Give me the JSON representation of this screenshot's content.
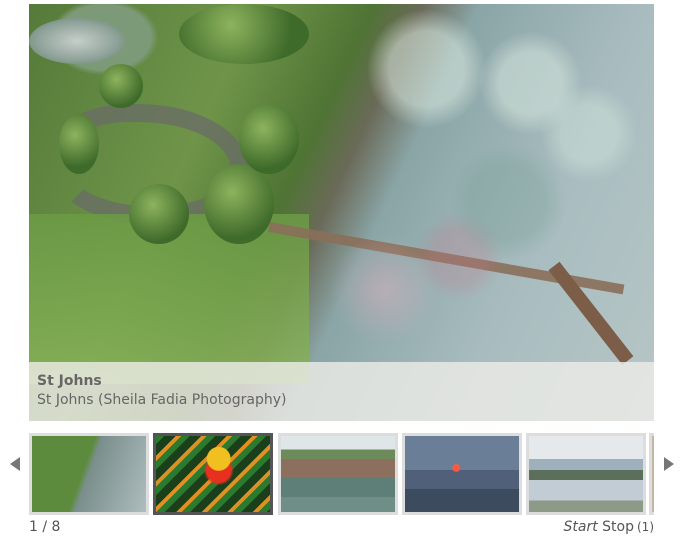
{
  "slide": {
    "title": "St Johns",
    "description": "St Johns (Sheila Fadia Photography)"
  },
  "thumbnails": [
    {
      "label": "aerial dock thumbnail"
    },
    {
      "label": "sunflower sculpture thumbnail"
    },
    {
      "label": "houses on water thumbnail"
    },
    {
      "label": "lit pavilion at dusk thumbnail"
    },
    {
      "label": "river landscape thumbnail"
    },
    {
      "label": "partial thumbnail"
    }
  ],
  "counter": {
    "current": "1",
    "separator": "/",
    "total": "8"
  },
  "controls": {
    "start_label": "Start",
    "stop_label": "Stop",
    "count_label": "(1)"
  },
  "icons": {
    "prev": "chevron-left-icon",
    "next": "chevron-right-icon"
  }
}
